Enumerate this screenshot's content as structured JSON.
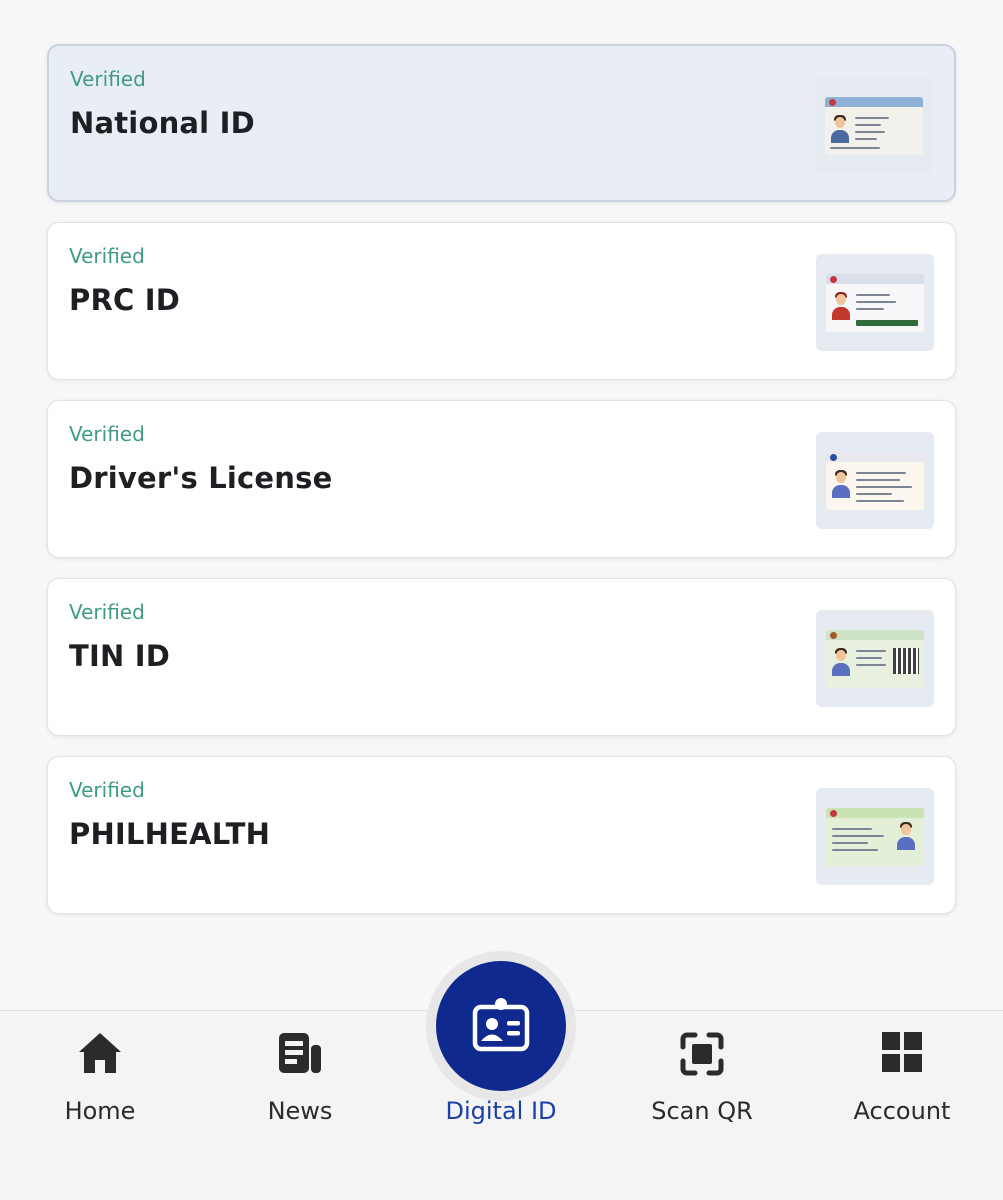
{
  "ids": [
    {
      "status": "Verified",
      "title": "National ID",
      "stripe": "#8fb0d6",
      "card_bg": "#f3f1ec",
      "has_qr": true
    },
    {
      "status": "Verified",
      "title": "PRC ID",
      "stripe": "#d9dee8",
      "card_bg": "#f7f7f9",
      "has_qr": false
    },
    {
      "status": "Verified",
      "title": "Driver's License",
      "stripe": "#e8e8ee",
      "card_bg": "#fbf7ef",
      "has_qr": false
    },
    {
      "status": "Verified",
      "title": "TIN ID",
      "stripe": "#cfe3c6",
      "card_bg": "#e8f1df",
      "has_qr": true
    },
    {
      "status": "Verified",
      "title": "PHILHEALTH",
      "stripe": "#c9e3b3",
      "card_bg": "#e3efd6",
      "has_qr": true
    }
  ],
  "nav": {
    "home": "Home",
    "news": "News",
    "digital_id": "Digital ID",
    "scan_qr": "Scan QR",
    "account": "Account"
  },
  "colors": {
    "verified": "#3f9b85",
    "accent": "#10298e",
    "active_label": "#1b3fa6"
  },
  "icons": {
    "home": "home-icon",
    "news": "news-icon",
    "digital_id": "id-badge-icon",
    "scan_qr": "scan-frame-icon",
    "account": "grid-icon"
  }
}
